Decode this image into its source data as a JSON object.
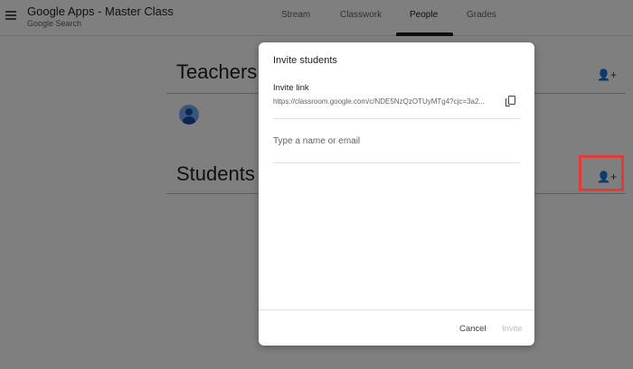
{
  "header": {
    "title": "Google Apps - Master Class",
    "subtitle": "Google Search",
    "tabs": [
      "Stream",
      "Classwork",
      "People",
      "Grades"
    ],
    "active_tab": "People"
  },
  "sections": {
    "teachers": "Teachers",
    "students": "Students"
  },
  "dialog": {
    "title": "Invite students",
    "link_label": "Invite link",
    "link": "https://classroom.google.com/c/NDE5NzQzOTUyMTg4?cjc=3a2...",
    "input_placeholder": "Type a name or email",
    "cancel": "Cancel",
    "invite": "Invite"
  },
  "colors": {
    "highlight": "#e53935"
  }
}
